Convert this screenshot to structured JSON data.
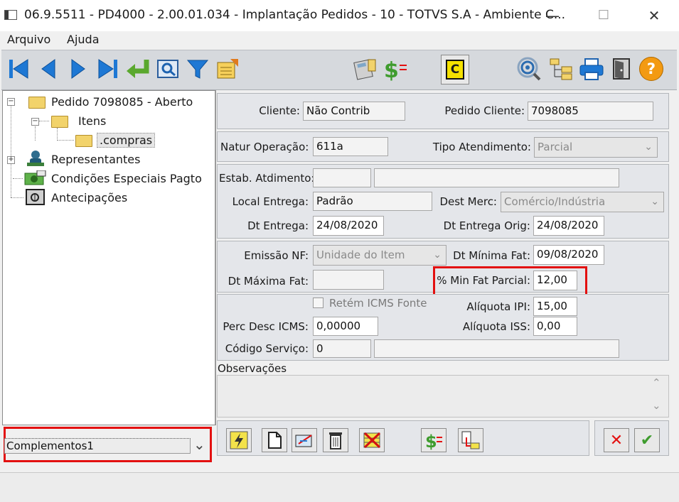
{
  "window": {
    "title": "06.9.5511 - PD4000 - 2.00.01.034 - Implantação Pedidos - 10 - TOTVS S.A - Ambiente C...",
    "minimize": "—",
    "maximize": "☐",
    "close": "✕"
  },
  "menu": {
    "file": "Arquivo",
    "help": "Ajuda"
  },
  "toolbar": {
    "icons": [
      "first-record-icon",
      "previous-record-icon",
      "next-record-icon",
      "last-record-icon",
      "return-icon",
      "preview-icon",
      "filter-icon",
      "notes-icon",
      "calculator-icon",
      "price-icon",
      "copy-c-icon",
      "search-icon",
      "tree-structure-icon",
      "print-icon",
      "exit-door-icon",
      "help-icon"
    ],
    "copy_c_label": "C",
    "help_label": "?"
  },
  "tree": {
    "root": "Pedido 7098085 - Aberto",
    "items": "Itens",
    "compras": ".compras",
    "representantes": "Representantes",
    "condicoes": "Condições Especiais Pagto",
    "antecipacoes": "Antecipações",
    "expander_minus": "−",
    "expander_plus": "+"
  },
  "combo": {
    "value": "Complementos1",
    "arrow": "⌄"
  },
  "form": {
    "cliente_label": "Cliente:",
    "cliente_value": "Não Contrib",
    "pedido_cliente_label": "Pedido Cliente:",
    "pedido_cliente_value": "7098085",
    "natur_label": "Natur Operação:",
    "natur_value": "611a",
    "tipo_label": "Tipo Atendimento:",
    "tipo_value": "Parcial",
    "estab_label": "Estab. Atdimento:",
    "estab_value": "",
    "local_label": "Local Entrega:",
    "local_value": "Padrão",
    "dest_label": "Dest Merc:",
    "dest_value": "Comércio/Indústria",
    "dt_entrega_label": "Dt Entrega:",
    "dt_entrega_value": "24/08/2020",
    "dt_entrega_orig_label": "Dt Entrega Orig:",
    "dt_entrega_orig_value": "24/08/2020",
    "emissao_label": "Emissão NF:",
    "emissao_value": "Unidade do Item",
    "dt_min_label": "Dt Mínima Fat:",
    "dt_min_value": "09/08/2020",
    "dt_max_label": "Dt Máxima Fat:",
    "dt_max_value": "",
    "min_fat_label": "% Min Fat Parcial:",
    "min_fat_value": "12,00",
    "retem_label": "Retém ICMS Fonte",
    "aliq_ipi_label": "Alíquota IPI:",
    "aliq_ipi_value": "15,00",
    "perc_desc_label": "Perc Desc ICMS:",
    "perc_desc_value": "0,00000",
    "aliq_iss_label": "Alíquota ISS:",
    "aliq_iss_value": "0,00",
    "codigo_label": "Código Serviço:",
    "codigo_value": "0",
    "obs_label": "Observações",
    "scroll_up": "⌃",
    "scroll_down": "⌄"
  },
  "buttons": {
    "icons": [
      "lightning-icon",
      "new-document-icon",
      "edit-icon",
      "trash-icon",
      "cancel-grid-icon",
      "money-icon",
      "import-icon",
      "cancel-icon",
      "confirm-icon"
    ],
    "cancel_glyph": "✕",
    "confirm_glyph": "✔"
  },
  "colors": {
    "highlight": "#e31010",
    "toolbar_blue": "#2a7fd4"
  }
}
